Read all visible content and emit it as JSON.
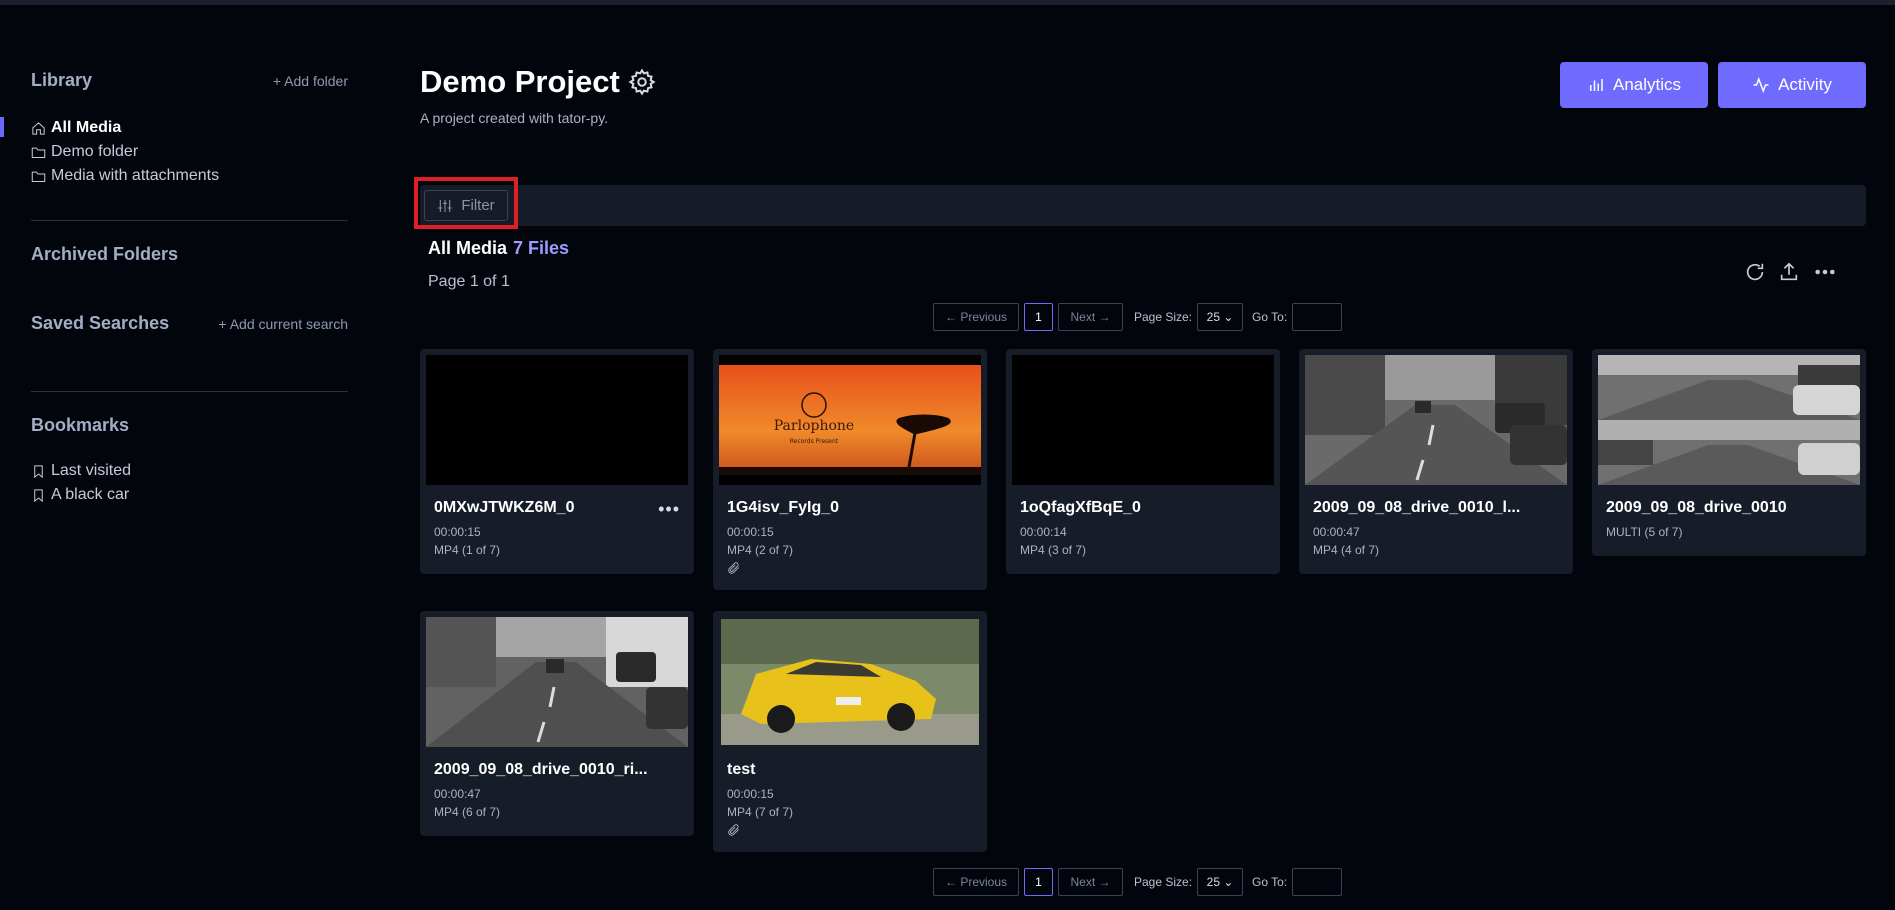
{
  "sidebar": {
    "library_title": "Library",
    "add_folder": "+ Add folder",
    "items": [
      {
        "label": "All Media"
      },
      {
        "label": "Demo folder"
      },
      {
        "label": "Media with attachments"
      }
    ],
    "archived_title": "Archived Folders",
    "saved_title": "Saved Searches",
    "add_current_search": "+ Add current search",
    "bookmarks_title": "Bookmarks",
    "bookmarks": [
      {
        "label": "Last visited"
      },
      {
        "label": "A black car"
      }
    ]
  },
  "header": {
    "title": "Demo Project",
    "subtitle": "A project created with tator-py.",
    "analytics_label": "Analytics",
    "activity_label": "Activity"
  },
  "filter": {
    "label": "Filter"
  },
  "section": {
    "title": "All Media",
    "count": "7 Files",
    "page_text": "Page 1 of 1"
  },
  "pagination": {
    "previous": "← Previous",
    "current": "1",
    "next": "Next →",
    "page_size_label": "Page Size:",
    "page_size": "25",
    "goto_label": "Go To:"
  },
  "cards": [
    {
      "name": "0MXwJTWKZ6M_0",
      "duration": "00:00:15",
      "type": "MP4  (1 of 7)"
    },
    {
      "name": "1G4isv_FyIg_0",
      "duration": "00:00:15",
      "type": "MP4  (2 of 7)"
    },
    {
      "name": "1oQfagXfBqE_0",
      "duration": "00:00:14",
      "type": "MP4  (3 of 7)"
    },
    {
      "name": "2009_09_08_drive_0010_l...",
      "duration": "00:00:47",
      "type": "MP4  (4 of 7)"
    },
    {
      "name": "2009_09_08_drive_0010",
      "type": "MULTI  (5 of 7)"
    },
    {
      "name": "2009_09_08_drive_0010_ri...",
      "duration": "00:00:47",
      "type": "MP4  (6 of 7)"
    },
    {
      "name": "test",
      "duration": "00:00:15",
      "type": "MP4  (7 of 7)"
    }
  ],
  "thumbnail_text": {
    "brand": "Parlophone",
    "tagline": "Records Present"
  },
  "colors": {
    "background": "#03050c",
    "accent": "#6f6bff",
    "card": "#171c29",
    "highlight": "#e01f25"
  }
}
